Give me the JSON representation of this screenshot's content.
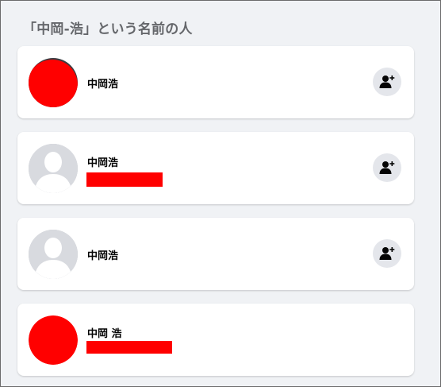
{
  "heading": "「中岡-浩」という名前の人",
  "people": [
    {
      "name": "中岡浩",
      "avatar": "red-photo"
    },
    {
      "name": "中岡浩",
      "avatar": "default-silhouette"
    },
    {
      "name": "中岡浩",
      "avatar": "default-silhouette"
    },
    {
      "name": "中岡 浩",
      "avatar": "red-photo"
    }
  ],
  "icons": {
    "add_friend": "add-friend-icon"
  },
  "colors": {
    "redaction": "#ff0000",
    "button_bg": "#e4e6eb",
    "page_bg": "#f0f2f5"
  }
}
